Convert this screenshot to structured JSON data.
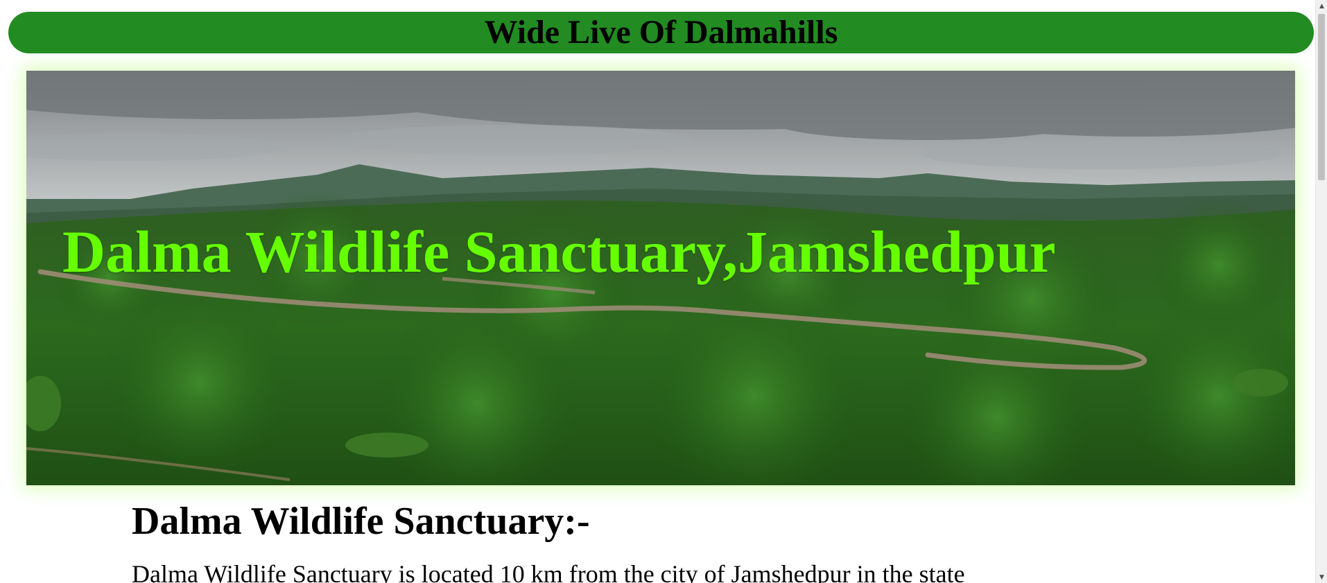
{
  "header": {
    "title": "Wide Live Of Dalmahills",
    "background_color": "#228b22"
  },
  "hero": {
    "title": "Dalma Wildlife Sanctuary,Jamshedpur",
    "title_color": "#66ff00",
    "image": "forested-hills-landscape"
  },
  "section": {
    "heading": "Dalma Wildlife Sanctuary:-",
    "paragraph": "Dalma Wildlife Sanctuary is located 10 km from the city of Jamshedpur in the state"
  },
  "scrollbar": {
    "up_icon": "triangle-up-icon",
    "down_icon": "triangle-down-icon"
  }
}
